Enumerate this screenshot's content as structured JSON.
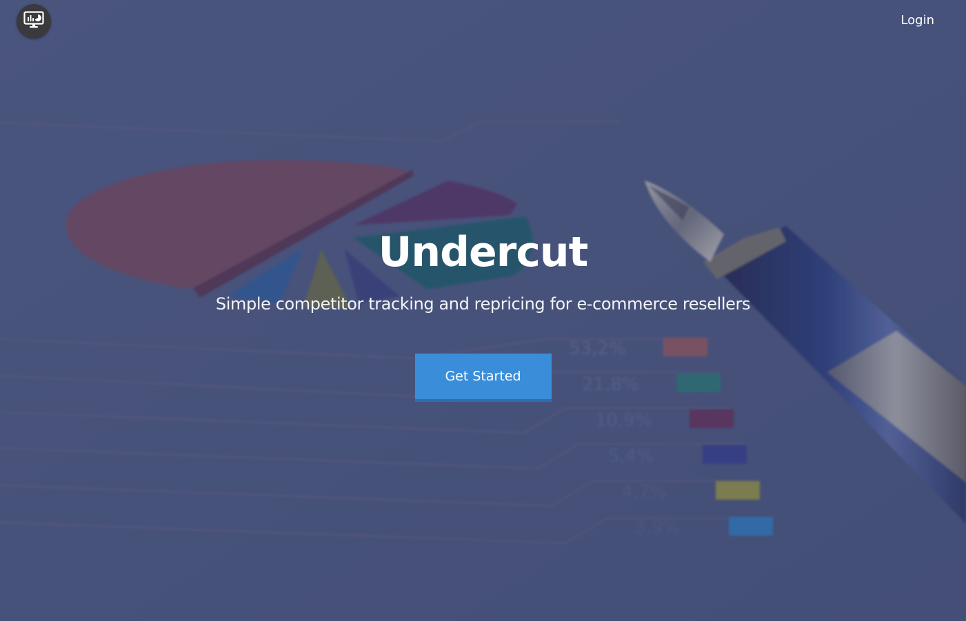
{
  "nav": {
    "logo_icon": "monitor-chart-icon",
    "login_label": "Login"
  },
  "hero": {
    "title": "Undercut",
    "subtitle": "Simple competitor tracking and repricing for e-commerce resellers",
    "cta_label": "Get Started"
  },
  "background": {
    "legend_values": [
      "53,2%",
      "21,8%",
      "10,9%",
      "5,4%",
      "4,7%",
      "3,9%"
    ],
    "legend_colors": [
      "#9a5a5a",
      "#2c7a70",
      "#6a2f55",
      "#343d8a",
      "#9e9a3a",
      "#2f7fc0"
    ]
  },
  "colors": {
    "overlay": "#4f5a7e",
    "accent": "#3a8ed9",
    "text": "#ffffff"
  }
}
